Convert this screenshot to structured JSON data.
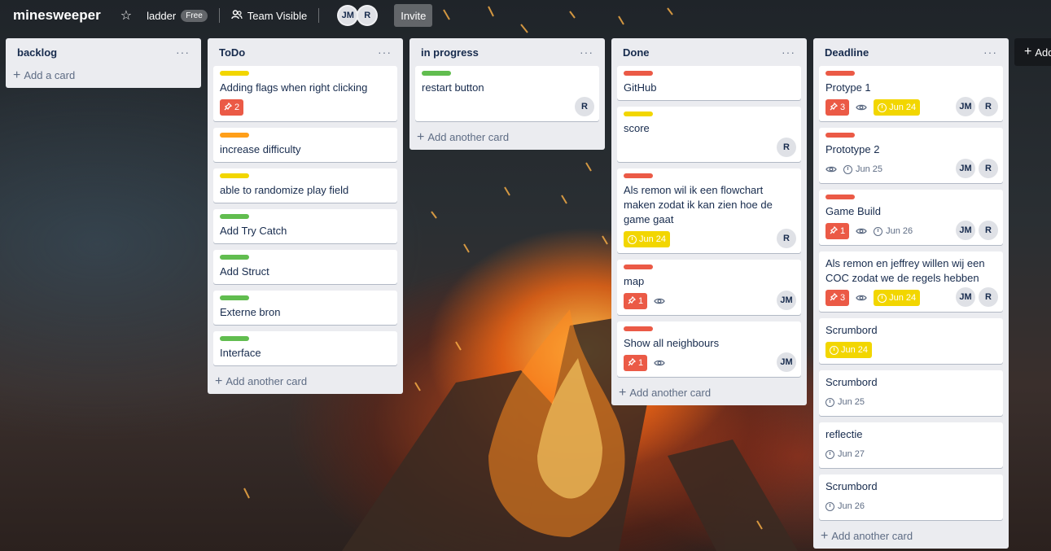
{
  "header": {
    "board_title": "minesweeper",
    "workspace": "ladder",
    "workspace_badge": "Free",
    "visibility": "Team Visible",
    "members": [
      "JM",
      "R"
    ],
    "invite": "Invite"
  },
  "colors": {
    "green": "#61bd4f",
    "yellow": "#f2d600",
    "orange": "#ff9f1a",
    "red": "#eb5a46"
  },
  "add_list_label": "Add",
  "lists": [
    {
      "title": "backlog",
      "add_label": "Add a card",
      "cards": []
    },
    {
      "title": "ToDo",
      "add_label": "Add another card",
      "cards": [
        {
          "label": "yellow",
          "title": "Adding flags when right clicking",
          "checklist": "2"
        },
        {
          "label": "orange",
          "title": "increase difficulty"
        },
        {
          "label": "yellow",
          "title": "able to randomize play field"
        },
        {
          "label": "green",
          "title": "Add Try Catch"
        },
        {
          "label": "green",
          "title": "Add Struct"
        },
        {
          "label": "green",
          "title": "Externe bron"
        },
        {
          "label": "green",
          "title": "Interface"
        }
      ]
    },
    {
      "title": "in progress",
      "add_label": "Add another card",
      "cards": [
        {
          "label": "green",
          "title": "restart button",
          "members": [
            "R"
          ]
        }
      ]
    },
    {
      "title": "Done",
      "add_label": "Add another card",
      "cards": [
        {
          "label": "red",
          "title": "GitHub"
        },
        {
          "label": "yellow",
          "title": "score",
          "members": [
            "R"
          ]
        },
        {
          "label": "red",
          "title": "Als remon wil ik een flowchart maken zodat ik kan zien hoe de game gaat",
          "due": "Jun 24",
          "due_style": "yellow",
          "members": [
            "R"
          ]
        },
        {
          "label": "red",
          "title": "map",
          "checklist": "1",
          "watch": true,
          "members": [
            "JM"
          ]
        },
        {
          "label": "red",
          "title": "Show all neighbours",
          "checklist": "1",
          "watch": true,
          "members": [
            "JM"
          ]
        }
      ]
    },
    {
      "title": "Deadline",
      "add_label": "Add another card",
      "cards": [
        {
          "label": "red",
          "title": "Protype 1",
          "checklist": "3",
          "watch": true,
          "due": "Jun 24",
          "due_style": "yellow",
          "members": [
            "JM",
            "R"
          ]
        },
        {
          "label": "red",
          "title": "Prototype 2",
          "watch": true,
          "due": "Jun 25",
          "due_style": "plain",
          "members": [
            "JM",
            "R"
          ]
        },
        {
          "label": "red",
          "title": "Game Build",
          "checklist": "1",
          "watch": true,
          "due": "Jun 26",
          "due_style": "plain",
          "members": [
            "JM",
            "R"
          ]
        },
        {
          "title": "Als remon en jeffrey willen wij een COC zodat we de regels hebben",
          "checklist": "3",
          "watch": true,
          "due": "Jun 24",
          "due_style": "yellow",
          "members": [
            "JM",
            "R"
          ]
        },
        {
          "title": "Scrumbord",
          "due": "Jun 24",
          "due_style": "yellow"
        },
        {
          "title": "Scrumbord",
          "due": "Jun 25",
          "due_style": "plain"
        },
        {
          "title": "reflectie",
          "due": "Jun 27",
          "due_style": "plain"
        },
        {
          "title": "Scrumbord",
          "due": "Jun 26",
          "due_style": "plain"
        }
      ]
    }
  ]
}
